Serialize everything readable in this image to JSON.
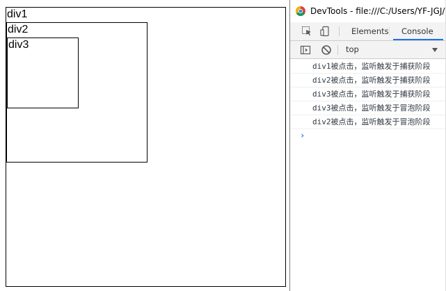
{
  "page": {
    "div1_label": "div1",
    "div2_label": "div2",
    "div3_label": "div3"
  },
  "devtools": {
    "title": "DevTools - file:///C:/Users/YF-JGJ/",
    "tabs": [
      {
        "label": "Elements",
        "active": false
      },
      {
        "label": "Console",
        "active": true
      }
    ],
    "context": "top",
    "accent_color": "#1a73e8",
    "console_messages": [
      "div1被点击，监听触发于捕获阶段",
      "div2被点击，监听触发于捕获阶段",
      "div3被点击，监听触发于捕获阶段",
      "div3被点击，监听触发于冒泡阶段",
      "div2被点击，监听触发于冒泡阶段"
    ],
    "prompt_symbol": "›"
  }
}
